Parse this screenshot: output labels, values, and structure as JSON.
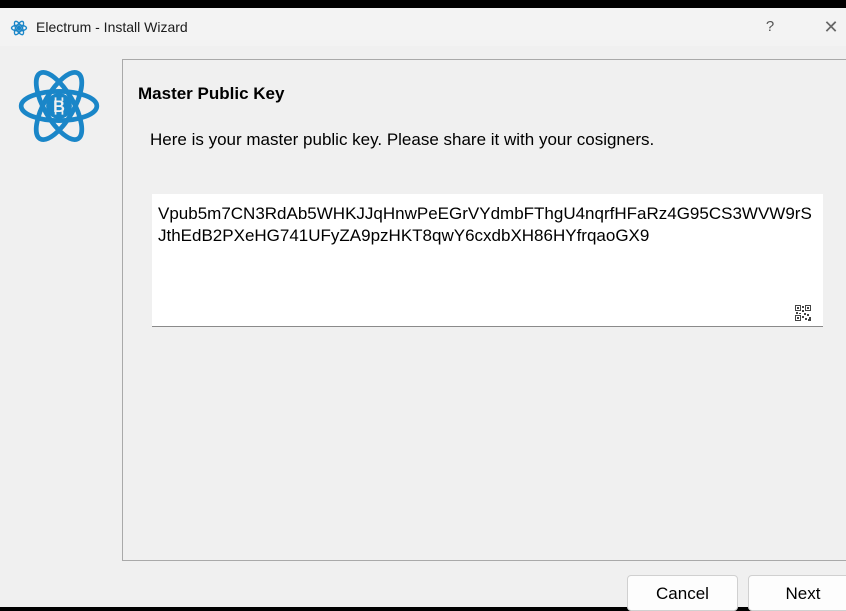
{
  "window": {
    "title": "Electrum  -  Install Wizard",
    "help_label": "?",
    "close_label": "✕"
  },
  "logo": {
    "icon": "electrum-bitcoin-atom-icon",
    "color": "#1a86c8"
  },
  "panel": {
    "title": "Master Public Key",
    "instructions": "Here is your master public key. Please share it with your cosigners.",
    "master_public_key": "Vpub5m7CN3RdAb5WHKJJqHnwPeEGrVYdmbFThgU4nqrfHFaRz4G95CS3WVW9rSJthEdB2PXeHG741UFyZA9pzHKT8qwY6cxdbXH86HYfrqaoGX9"
  },
  "buttons": {
    "cancel": "Cancel",
    "next": "Next"
  },
  "colors": {
    "accent": "#1a86c8",
    "window_bg": "#f0f0f0"
  }
}
